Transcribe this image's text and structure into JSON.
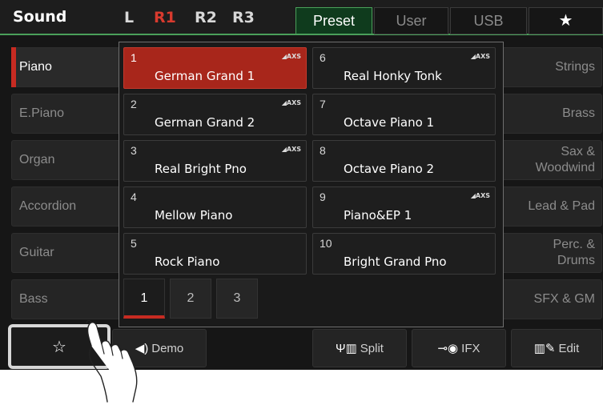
{
  "header": {
    "title": "Sound",
    "parts": [
      "L",
      "R1",
      "R2",
      "R3"
    ],
    "active_part": "R1",
    "tabs": [
      "Preset",
      "User",
      "USB"
    ],
    "active_tab": "Preset",
    "favorites_icon": "star-icon"
  },
  "left_categories": [
    "Piano",
    "E.Piano",
    "Organ",
    "Accordion",
    "Guitar",
    "Bass"
  ],
  "right_categories": [
    "Strings",
    "Brass",
    "Sax & Woodwind",
    "Lead & Pad",
    "Perc. & Drums",
    "SFX & GM"
  ],
  "selected_category": "Piano",
  "voices": [
    {
      "num": "1",
      "name": "German Grand 1",
      "badge": "AXS"
    },
    {
      "num": "2",
      "name": "German Grand 2",
      "badge": "AXS"
    },
    {
      "num": "3",
      "name": "Real Bright Pno",
      "badge": "AXS"
    },
    {
      "num": "4",
      "name": "Mellow Piano",
      "badge": ""
    },
    {
      "num": "5",
      "name": "Rock Piano",
      "badge": ""
    },
    {
      "num": "6",
      "name": "Real Honky Tonk",
      "badge": "AXS"
    },
    {
      "num": "7",
      "name": "Octave Piano 1",
      "badge": ""
    },
    {
      "num": "8",
      "name": "Octave Piano 2",
      "badge": ""
    },
    {
      "num": "9",
      "name": "Piano&EP 1",
      "badge": "AXS"
    },
    {
      "num": "10",
      "name": "Bright Grand Pno",
      "badge": ""
    }
  ],
  "selected_voice": "1",
  "pages": [
    "1",
    "2",
    "3"
  ],
  "active_page": "1",
  "bottom_bar": {
    "favorite_icon": "star-outline-icon",
    "demo_label": "Demo",
    "split_label": "Split",
    "ifx_label": "IFX",
    "edit_label": "Edit"
  },
  "colors": {
    "accent_green": "#4aa05a",
    "accent_red": "#c72b22",
    "selected_voice_bg": "#a8261b"
  }
}
